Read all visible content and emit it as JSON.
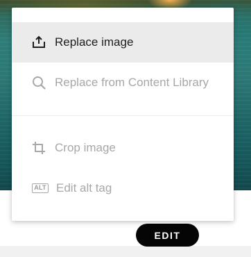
{
  "menu": {
    "items": [
      {
        "label": "Replace image",
        "icon": "upload-icon",
        "state": "active"
      },
      {
        "label": "Replace from Content Library",
        "icon": "search-icon",
        "state": "disabled"
      },
      {
        "label": "Crop image",
        "icon": "crop-icon",
        "state": "disabled"
      },
      {
        "label": "Edit alt tag",
        "icon": "alt-tag-icon",
        "icon_text": "ALT",
        "state": "disabled"
      }
    ]
  },
  "edit_button": {
    "label": "EDIT"
  },
  "colors": {
    "active_text": "#1c1c1c",
    "disabled_text": "#a7a7a7",
    "active_bg": "#ebebeb",
    "button_bg": "#050505",
    "button_text": "#ffffff"
  }
}
